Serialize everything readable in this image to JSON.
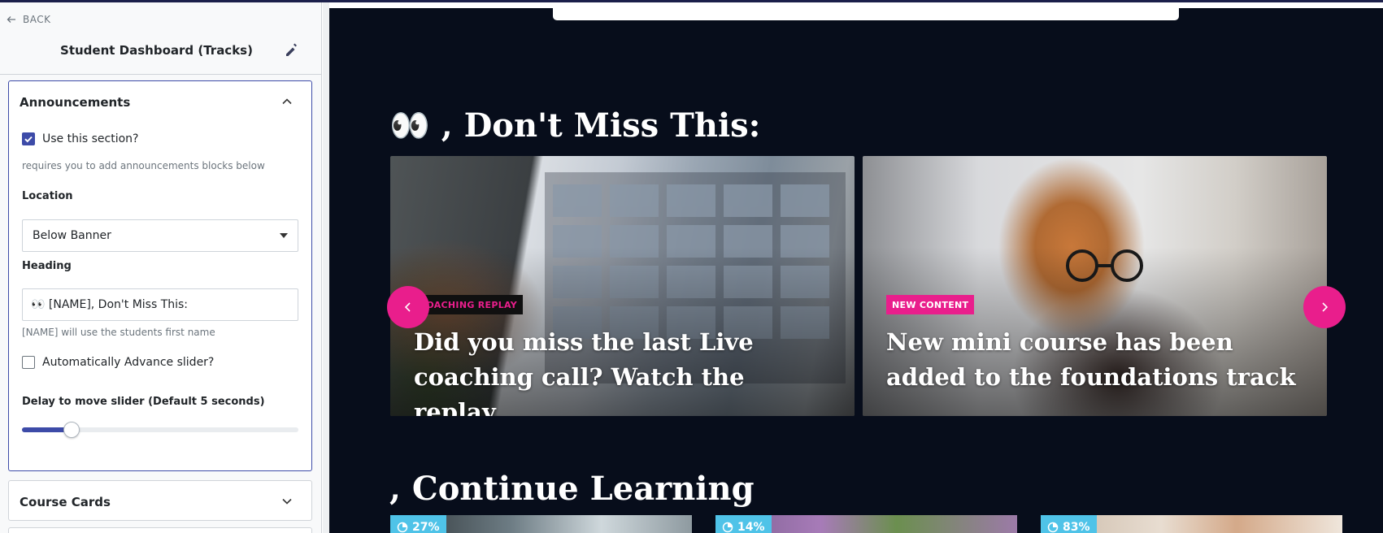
{
  "sidebar": {
    "back_label": "BACK",
    "title": "Student Dashboard (Tracks)",
    "announcements": {
      "header": "Announcements",
      "use_section_label": "Use this section?",
      "use_section_checked": true,
      "use_section_help": "requires you to add announcements blocks below",
      "location_label": "Location",
      "location_value": "Below Banner",
      "heading_label": "Heading",
      "heading_value": "👀 [NAME], Don't Miss This:",
      "heading_help": "[NAME] will use the students first name",
      "auto_advance_label": "Automatically Advance slider?",
      "auto_advance_checked": false,
      "delay_label": "Delay to move slider (Default 5 seconds)",
      "delay_slider_fraction": 0.18
    },
    "course_cards": {
      "header": "Course Cards"
    }
  },
  "preview": {
    "announcements_heading": "👀 , Don't Miss This:",
    "slides": [
      {
        "tag": "COACHING REPLAY",
        "title": "Did you miss the last Live coaching call? Watch the replay."
      },
      {
        "tag": "NEW CONTENT",
        "title": "New mini course has been added to the foundations track"
      }
    ],
    "continue_heading": ", Continue Learning",
    "progress_cards": [
      {
        "progress": "27%"
      },
      {
        "progress": "14%"
      },
      {
        "progress": "83%"
      }
    ]
  },
  "colors": {
    "accent": "#3d4ba8",
    "pink": "#e91e8c",
    "preview_bg": "#070d1b",
    "progress_badge": "#4fc3e8"
  },
  "icons": [
    "arrow-left-icon",
    "pencil-icon",
    "chevron-up-icon",
    "chevron-down-icon",
    "check-icon",
    "caret-down-icon",
    "chevron-left-icon",
    "chevron-right-icon",
    "pie-progress-icon"
  ]
}
